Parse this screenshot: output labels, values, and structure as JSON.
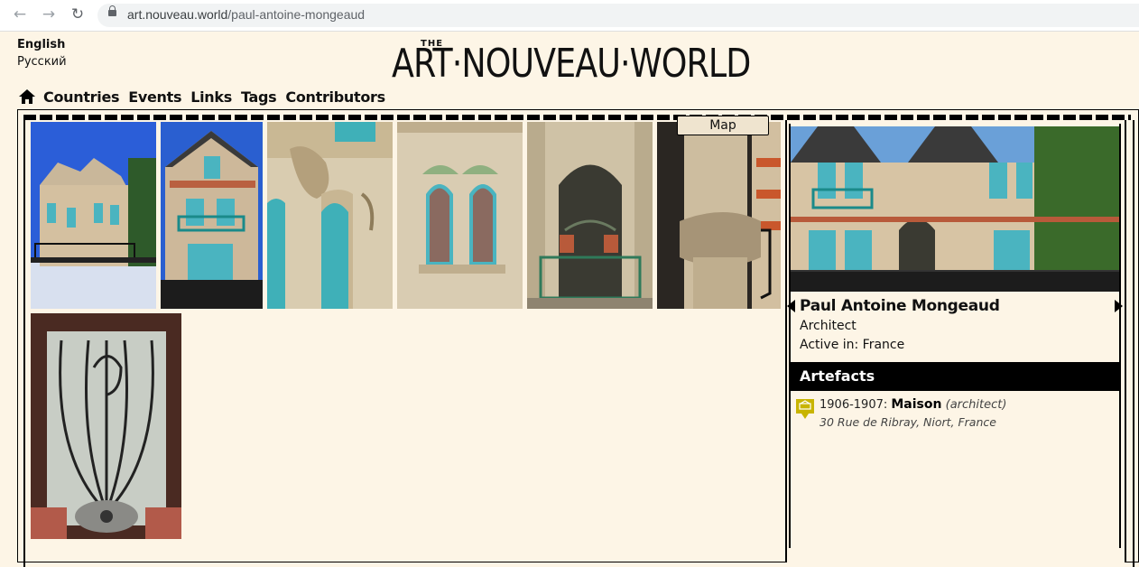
{
  "browser": {
    "url_host": "art.nouveau.world",
    "url_path": "/paul-antoine-mongeaud",
    "back_icon": "arrow-left-icon",
    "forward_icon": "arrow-right-icon",
    "reload_icon": "reload-icon"
  },
  "languages": [
    "English",
    "Русский"
  ],
  "logo": {
    "the": "THE",
    "main": "ART·NOUVEAU·WORLD"
  },
  "nav": {
    "home_icon": "home-icon",
    "items": [
      "Countries",
      "Events",
      "Links",
      "Tags",
      "Contributors"
    ]
  },
  "gallery": {
    "map_label": "Map",
    "photos": [
      {
        "name": "photo-villa-facade"
      },
      {
        "name": "photo-gable-balcony"
      },
      {
        "name": "photo-carved-corner"
      },
      {
        "name": "photo-twin-windows"
      },
      {
        "name": "photo-arched-door"
      },
      {
        "name": "photo-capital-detail"
      },
      {
        "name": "photo-ironwork-door"
      }
    ]
  },
  "panel": {
    "name": "Paul Antoine Mongeaud",
    "role": "Architect",
    "active": "Active in: France",
    "artefacts_heading": "Artefacts",
    "artefacts": [
      {
        "years": "1906-1907: ",
        "title": "Maison",
        "role": "(architect)",
        "address": "30 Rue de Ribray, Niort, France"
      }
    ]
  },
  "colors": {
    "background": "#fdf5e6",
    "accent": "#000000",
    "artefact_icon": "#c8b400"
  }
}
